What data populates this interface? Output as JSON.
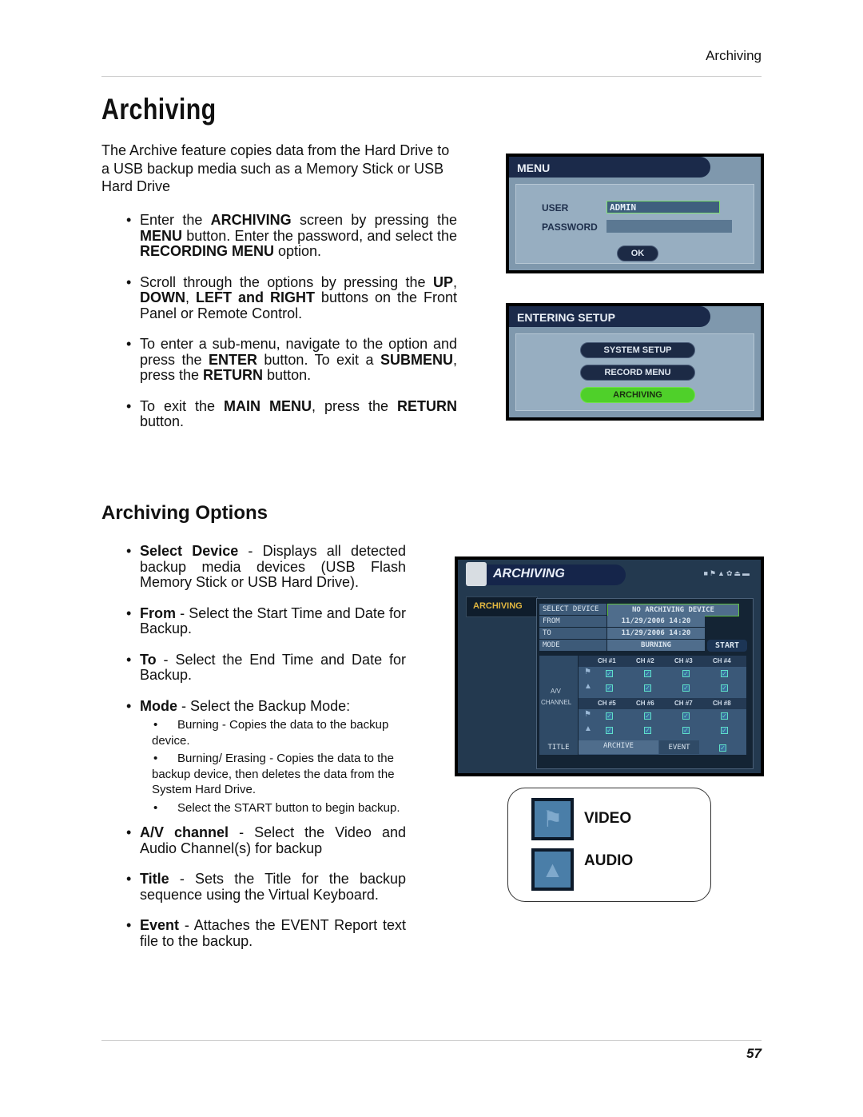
{
  "running_head": "Archiving",
  "title": "Archiving",
  "intro": "The Archive feature copies data from the Hard Drive to a USB backup media such as a Memory Stick or USB Hard Drive",
  "bullets1": [
    [
      {
        "t": "Enter the "
      },
      {
        "t": "ARCHIVING",
        "b": true
      },
      {
        "t": " screen by pressing the "
      },
      {
        "t": "MENU",
        "b": true
      },
      {
        "t": " button. Enter the password, and select the "
      },
      {
        "t": "RECORDING MENU",
        "b": true
      },
      {
        "t": " option."
      }
    ],
    [
      {
        "t": "Scroll through the options by pressing the "
      },
      {
        "t": "UP",
        "b": true
      },
      {
        "t": ", "
      },
      {
        "t": "DOWN",
        "b": true
      },
      {
        "t": ", "
      },
      {
        "t": "LEFT and RIGHT",
        "b": true
      },
      {
        "t": " buttons on the Front Panel or Remote Control."
      }
    ],
    [
      {
        "t": "To enter a sub-menu, navigate to the option and press the "
      },
      {
        "t": "ENTER",
        "b": true
      },
      {
        "t": " button. To exit a "
      },
      {
        "t": "SUBMENU",
        "b": true
      },
      {
        "t": ", press the "
      },
      {
        "t": "RETURN",
        "b": true
      },
      {
        "t": " button."
      }
    ],
    [
      {
        "t": "To exit the "
      },
      {
        "t": "MAIN MENU",
        "b": true
      },
      {
        "t": ", press the "
      },
      {
        "t": "RETURN",
        "b": true
      },
      {
        "t": " button."
      }
    ]
  ],
  "section_title": "Archiving Options",
  "bullets2": [
    [
      {
        "t": "Select Device",
        "b": true
      },
      {
        "t": " - Displays all detected backup media devices (USB Flash Memory Stick or USB Hard Drive)."
      }
    ],
    [
      {
        "t": "From",
        "b": true
      },
      {
        "t": " - Select the Start Time and Date for Backup."
      }
    ],
    [
      {
        "t": "To",
        "b": true
      },
      {
        "t": " - Select the End Time and Date for Backup."
      }
    ],
    [
      {
        "t": "Mode",
        "b": true
      },
      {
        "t": " - Select the Backup Mode:"
      }
    ],
    [
      {
        "t": "A/V channel",
        "b": true
      },
      {
        "t": " - Select the Video and Audio Channel(s) for backup"
      }
    ],
    [
      {
        "t": "Title",
        "b": true
      },
      {
        "t": " - Sets the Title for the backup sequence using the Virtual Keyboard."
      }
    ],
    [
      {
        "t": "Event",
        "b": true
      },
      {
        "t": " - Attaches the EVENT Report text file to the backup."
      }
    ]
  ],
  "mode_subbullets": [
    "Burning - Copies the data to the backup device.",
    "Burning/ Erasing - Copies the data to the backup device, then deletes the data from the System Hard Drive.",
    "Select the START button to begin backup."
  ],
  "menu_screen": {
    "title": "MENU",
    "user_label": "USER",
    "user_value": "ADMIN",
    "password_label": "PASSWORD",
    "ok": "OK"
  },
  "setup_screen": {
    "title": "ENTERING SETUP",
    "items": [
      "SYSTEM SETUP",
      "RECORD MENU",
      "ARCHIVING"
    ],
    "selected_color": "#4fd02a"
  },
  "archive_screen": {
    "title": "ARCHIVING",
    "tab": "ARCHIVING",
    "select_device_label": "SELECT DEVICE",
    "select_device_value": "NO ARCHIVING DEVICE",
    "from_label": "FROM",
    "from_value": "11/29/2006  14:20",
    "to_label": "TO",
    "to_value": "11/29/2006  14:20",
    "mode_label": "MODE",
    "mode_value": "BURNING",
    "start": "START",
    "av_label": "A/V",
    "channel_label": "CHANNEL",
    "channels": [
      "CH #1",
      "CH #2",
      "CH #3",
      "CH #4",
      "CH #5",
      "CH #6",
      "CH #7",
      "CH #8"
    ],
    "title_label": "TITLE",
    "title_value": "ARCHIVE",
    "event_label": "EVENT"
  },
  "legend": {
    "video": "VIDEO",
    "audio": "AUDIO"
  },
  "page_number": "57"
}
